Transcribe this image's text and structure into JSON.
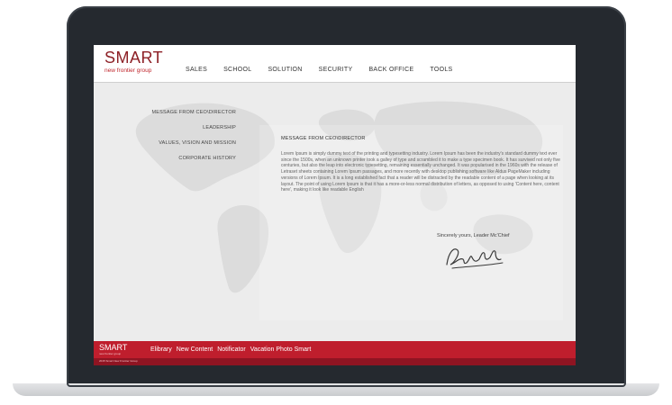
{
  "logo": {
    "title": "SMART",
    "subtitle": "new frontier group"
  },
  "nav": [
    "SALES",
    "SCHOOL",
    "SOLUTION",
    "SECURITY",
    "BACK OFFICE",
    "TOOLS"
  ],
  "sidebar": [
    "MESSAGE FROM CEO\\DIRECTOR",
    "LEADERSHIP",
    "VALUES, VISION AND MISSION",
    "CORPORATE HISTORY"
  ],
  "content": {
    "heading": "MESSAGE FROM CEO\\DIRECTOR",
    "body": "Lorem Ipsum is simply dummy text of the printing and typesetting industry. Lorem Ipsum has been the industry's standard dummy text ever since the 1500s, when an unknown printer took a galley of type and scrambled it to make a type specimen book. It has survived not only five centuries, but also the leap into electronic typesetting, remaining essentially unchanged. It was popularised in the 1960s with the release of Letraset sheets containing Lorem Ipsum passages, and more recently with desktop publishing software like Aldus PageMaker including versions of Lorem Ipsum. It is a long established fact that a reader will be distracted by the readable content of a page when looking at its layout. The point of using Lorem Ipsum is that it has a more-or-less normal distribution of letters, as opposed to using 'Content here, content here', making it look like readable English",
    "signoff": "Sincerely yours, Leader Mc'Chief"
  },
  "footer": {
    "logo_title": "SMART",
    "logo_subtitle": "new frontier group",
    "links": [
      "Elibrary",
      "New Content",
      "Notificator",
      "Vacation Photo Smart"
    ],
    "copyright": "2015 Smart New Frontier Group"
  },
  "colors": {
    "brand_red": "#bf1e2d",
    "brand_dark_red": "#8d2026",
    "laptop_frame": "#25292f"
  },
  "icons": [
    "signature-image",
    "world-map-background"
  ]
}
